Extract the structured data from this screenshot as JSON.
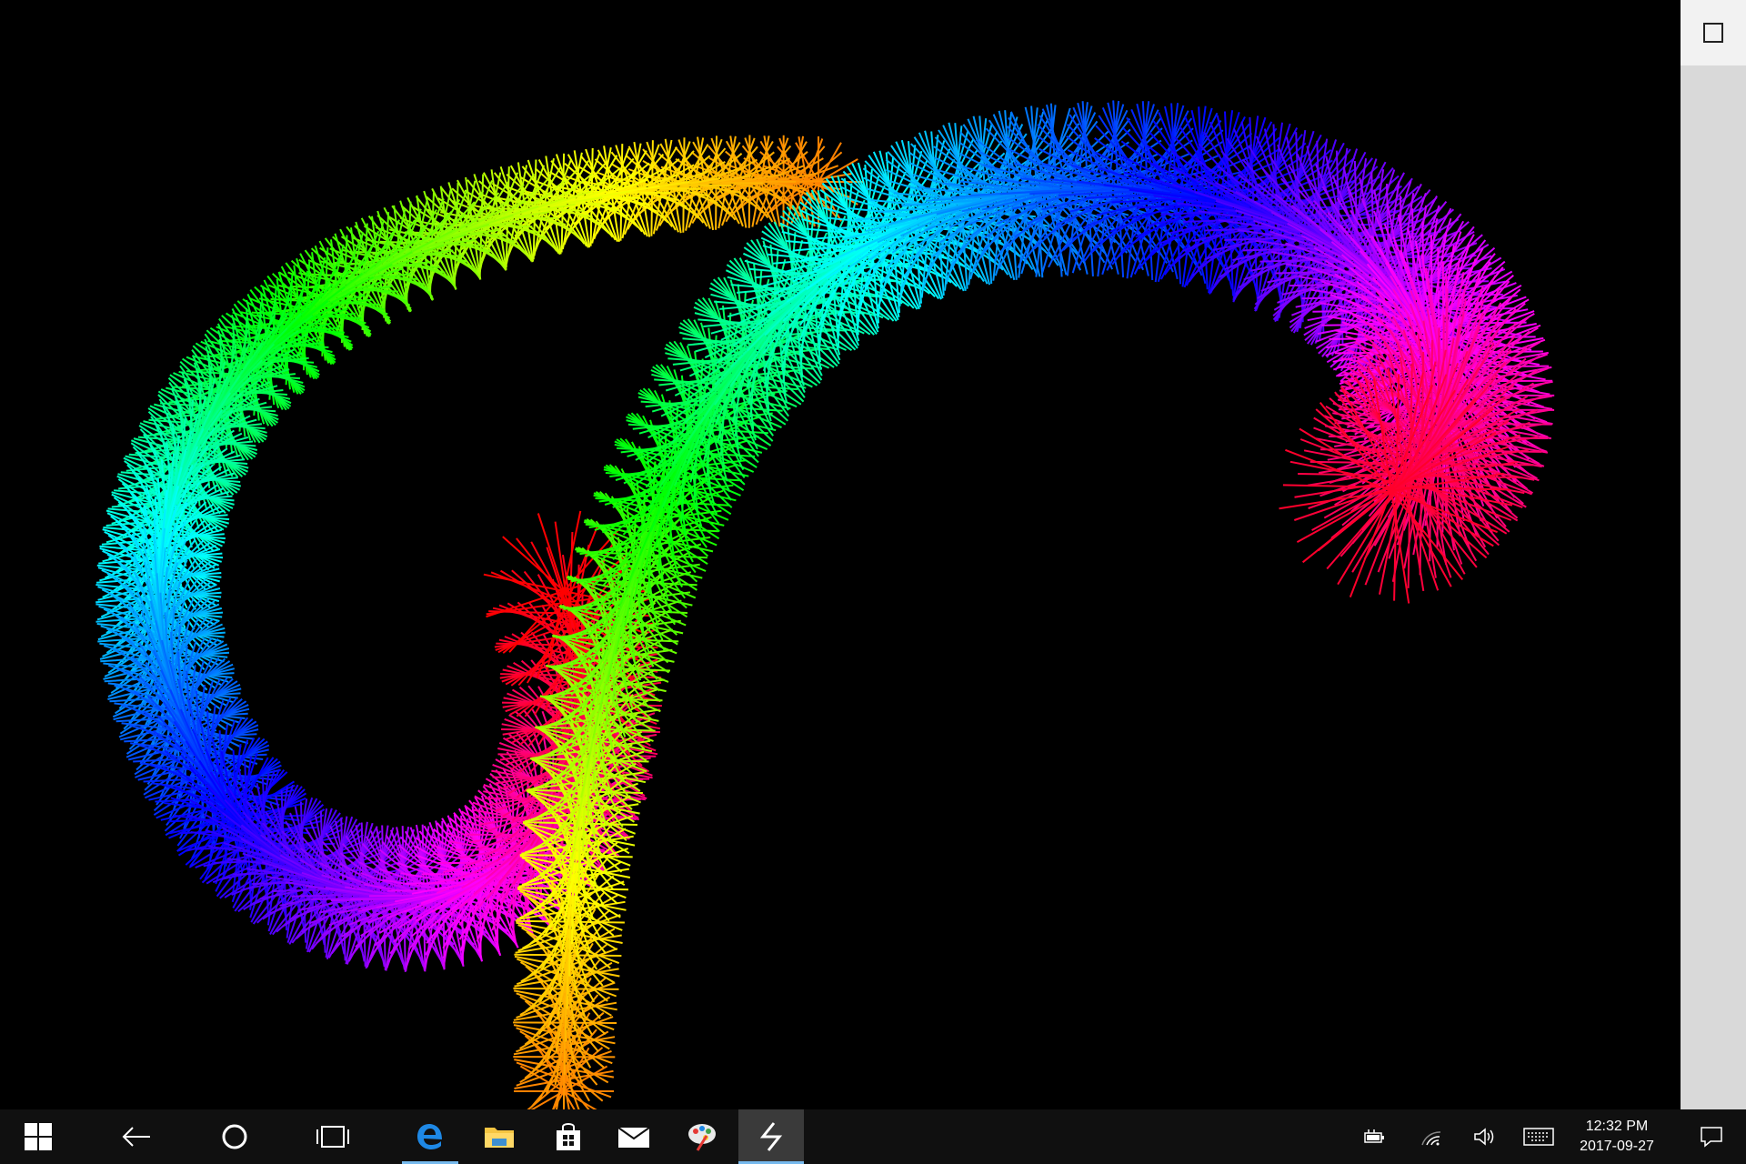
{
  "canvas": {
    "background": "#000000"
  },
  "right_rail": {
    "icon": "maximize-square-icon"
  },
  "taskbar": {
    "background": "#101010",
    "accent": "#76b9ed",
    "buttons": [
      {
        "icon": "windows-start-icon"
      },
      {
        "icon": "back-arrow-icon"
      },
      {
        "icon": "cortana-circle-icon"
      },
      {
        "icon": "task-view-icon"
      },
      {
        "icon": "edge-browser-icon"
      },
      {
        "icon": "file-explorer-icon"
      },
      {
        "icon": "store-bag-icon"
      },
      {
        "icon": "mail-envelope-icon"
      },
      {
        "icon": "paint-palette-icon"
      },
      {
        "icon": "app-lightning-icon"
      }
    ],
    "tray": [
      {
        "icon": "battery-icon"
      },
      {
        "icon": "wifi-icon"
      },
      {
        "icon": "volume-icon"
      },
      {
        "icon": "keyboard-icon"
      }
    ],
    "clock": {
      "time": "12:32 PM",
      "date": "2017-09-27"
    },
    "notifications": {
      "icon": "action-center-icon"
    }
  }
}
